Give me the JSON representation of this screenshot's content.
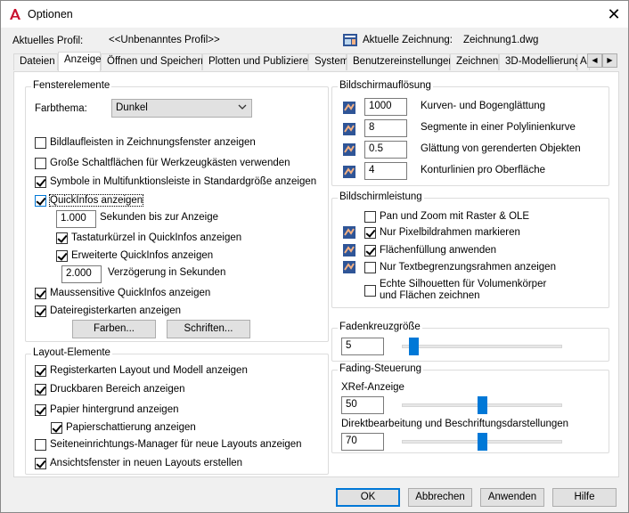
{
  "window": {
    "title": "Optionen"
  },
  "header": {
    "profile_label": "Aktuelles Profil:",
    "profile_value": "<<Unbenanntes Profil>>",
    "drawing_label": "Aktuelle Zeichnung:",
    "drawing_value": "Zeichnung1.dwg"
  },
  "tabs": [
    "Dateien",
    "Anzeige",
    "Öffnen und Speichern",
    "Plotten und Publizieren",
    "System",
    "Benutzereinstellungen",
    "Zeichnen",
    "3D-Modellierung",
    "Au"
  ],
  "window_elements": {
    "title": "Fensterelemente",
    "color_theme_label": "Farbthema:",
    "color_theme_value": "Dunkel",
    "options": [
      {
        "label": "Bildlaufleisten in Zeichnungsfenster anzeigen",
        "checked": false
      },
      {
        "label": "Große Schaltflächen für Werkzeugkästen verwenden",
        "checked": false
      },
      {
        "label": "Symbole in Multifunktionsleiste in Standardgröße anzeigen",
        "checked": true
      },
      {
        "label": "QuickInfos anzeigen",
        "checked": true
      }
    ],
    "tooltip_delay_value": "1.000",
    "tooltip_delay_label": "Sekunden bis zur Anzeige",
    "shortcut_label": "Tastaturkürzel in QuickInfos anzeigen",
    "extended_label": "Erweiterte QuickInfos anzeigen",
    "delay_value": "2.000",
    "delay_label": "Verzögerung in Sekunden",
    "mouse_label": "Maussensitive QuickInfos anzeigen",
    "filetabs_label": "Dateiregisterkarten anzeigen",
    "colors_button": "Farben...",
    "fonts_button": "Schriften..."
  },
  "layout_elements": {
    "title": "Layout-Elemente",
    "options": [
      "Registerkarten Layout und Modell anzeigen",
      "Druckbaren Bereich anzeigen",
      "Papier hintergrund anzeigen",
      "Papierschattierung anzeigen",
      "Seiteneinrichtungs-Manager für neue Layouts anzeigen",
      "Ansichtsfenster in neuen Layouts erstellen"
    ]
  },
  "resolution": {
    "title": "Bildschirmauflösung",
    "items": [
      {
        "value": "1000",
        "label": "Kurven- und Bogenglättung"
      },
      {
        "value": "8",
        "label": "Segmente in einer Polylinienkurve"
      },
      {
        "value": "0.5",
        "label": "Glättung von gerenderten Objekten"
      },
      {
        "value": "4",
        "label": "Konturlinien pro Oberfläche"
      }
    ]
  },
  "performance": {
    "title": "Bildschirmleistung",
    "options": [
      "Pan und Zoom mit Raster & OLE",
      "Nur Pixelbildrahmen markieren",
      "Flächenfüllung anwenden",
      "Nur Textbegrenzungsrahmen anzeigen",
      "Echte Silhouetten für Volumenkörper",
      "und Flächen zeichnen"
    ]
  },
  "crosshair": {
    "title": "Fadenkreuzgröße",
    "value": "5",
    "level": 0.05
  },
  "fading": {
    "title": "Fading-Steuerung",
    "xref_label": "XRef-Anzeige",
    "xref_value": "50",
    "xref_level": 0.5,
    "edit_label": "Direktbearbeitung und Beschriftungsdarstellungen",
    "edit_value": "70",
    "edit_level": 0.5
  },
  "footer": {
    "ok": "OK",
    "cancel": "Abbrechen",
    "apply": "Anwenden",
    "help": "Hilfe"
  },
  "colors": {
    "accent": "#0078d7",
    "brand": "#c8102e"
  }
}
